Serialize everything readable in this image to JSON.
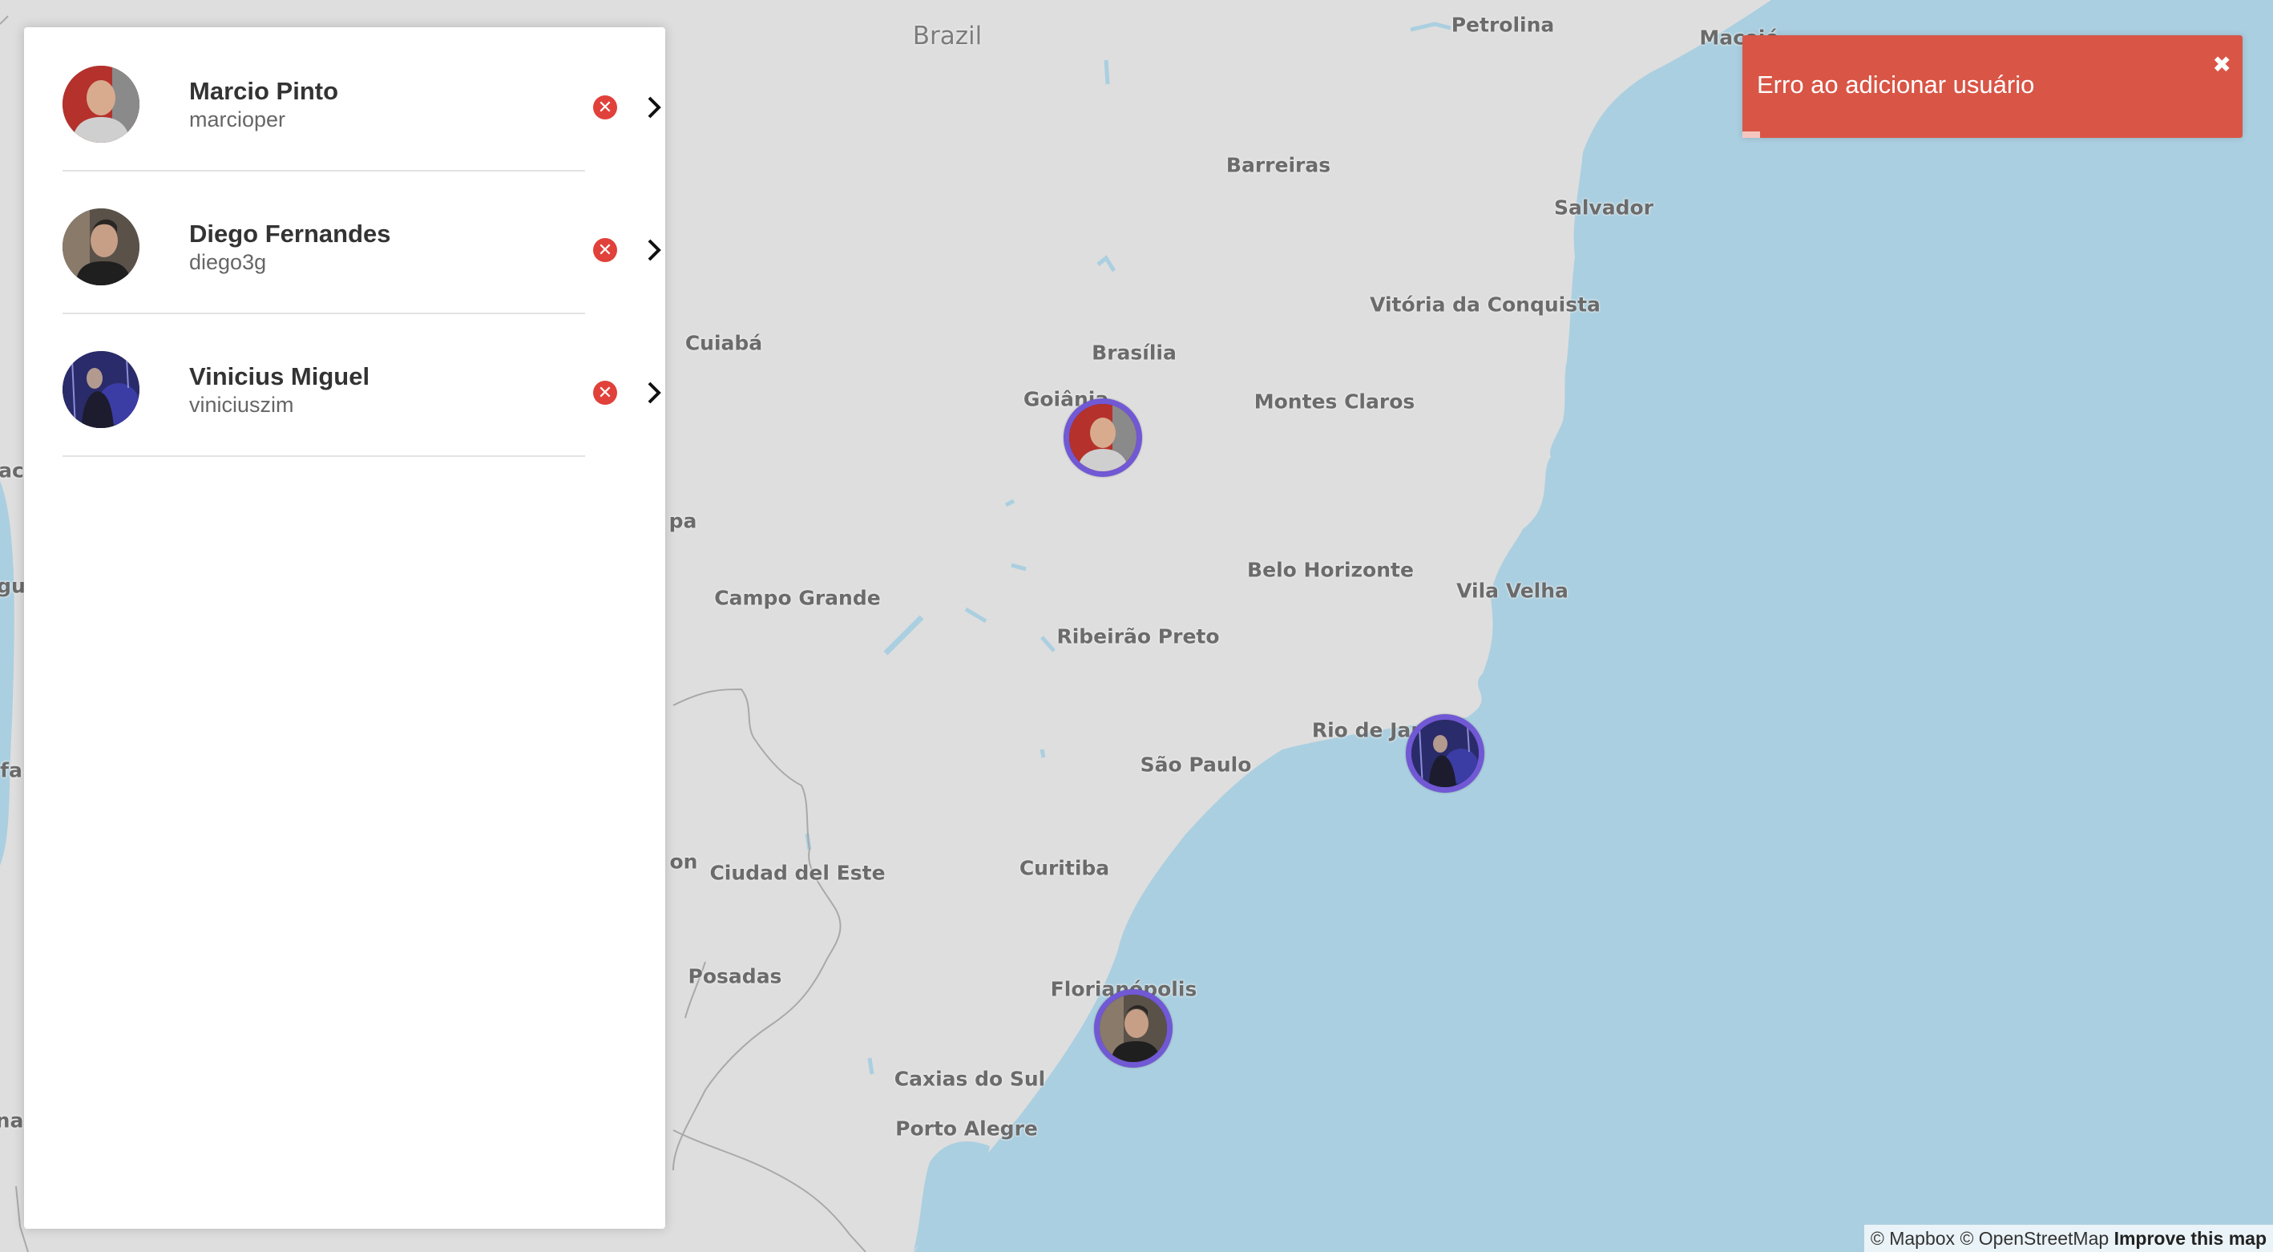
{
  "users": [
    {
      "name": "Marcio Pinto",
      "login": "marcioper"
    },
    {
      "name": "Diego Fernandes",
      "login": "diego3g"
    },
    {
      "name": "Vinicius Miguel",
      "login": "viniciuszim"
    }
  ],
  "user_actions": {
    "remove_icon": "x-circle-icon",
    "open_icon": "chevron-right-icon"
  },
  "toast": {
    "message": "Erro ao adicionar usuário",
    "close_glyph": "✖"
  },
  "map": {
    "country": "Brazil",
    "cities": {
      "petrolina": "Petrolina",
      "maceio": "Maceió",
      "barreiras": "Barreiras",
      "salvador": "Salvador",
      "vitoria_conquista": "Vitória da Conquista",
      "cuiaba": "Cuiabá",
      "brasilia": "Brasília",
      "goiania": "Goiânia",
      "montes_claros": "Montes Claros",
      "belo_horizonte": "Belo Horizonte",
      "vila_velha": "Vila Velha",
      "campo_grande": "Campo Grande",
      "ribeirao_preto": "Ribeirão Preto",
      "rio": "Rio de Janeiro",
      "sao_paulo": "São Paulo",
      "ciudad_del_este": "Ciudad del Este",
      "curitiba": "Curitiba",
      "posadas": "Posadas",
      "florianopolis": "Florianópolis",
      "caxias": "Caxias do Sul",
      "porto_alegre": "Porto Alegre"
    },
    "edge_fragments": [
      "ac",
      "gu",
      "fa",
      "na",
      "pa",
      "on"
    ]
  },
  "attribution": {
    "mapbox": "© Mapbox",
    "osm": "© OpenStreetMap",
    "improve": "Improve this map"
  },
  "colors": {
    "water": "#aacfe0",
    "land": "#dedede",
    "marker_ring": "#7158d4",
    "toast": "#d95546",
    "remove": "#e0413a"
  }
}
